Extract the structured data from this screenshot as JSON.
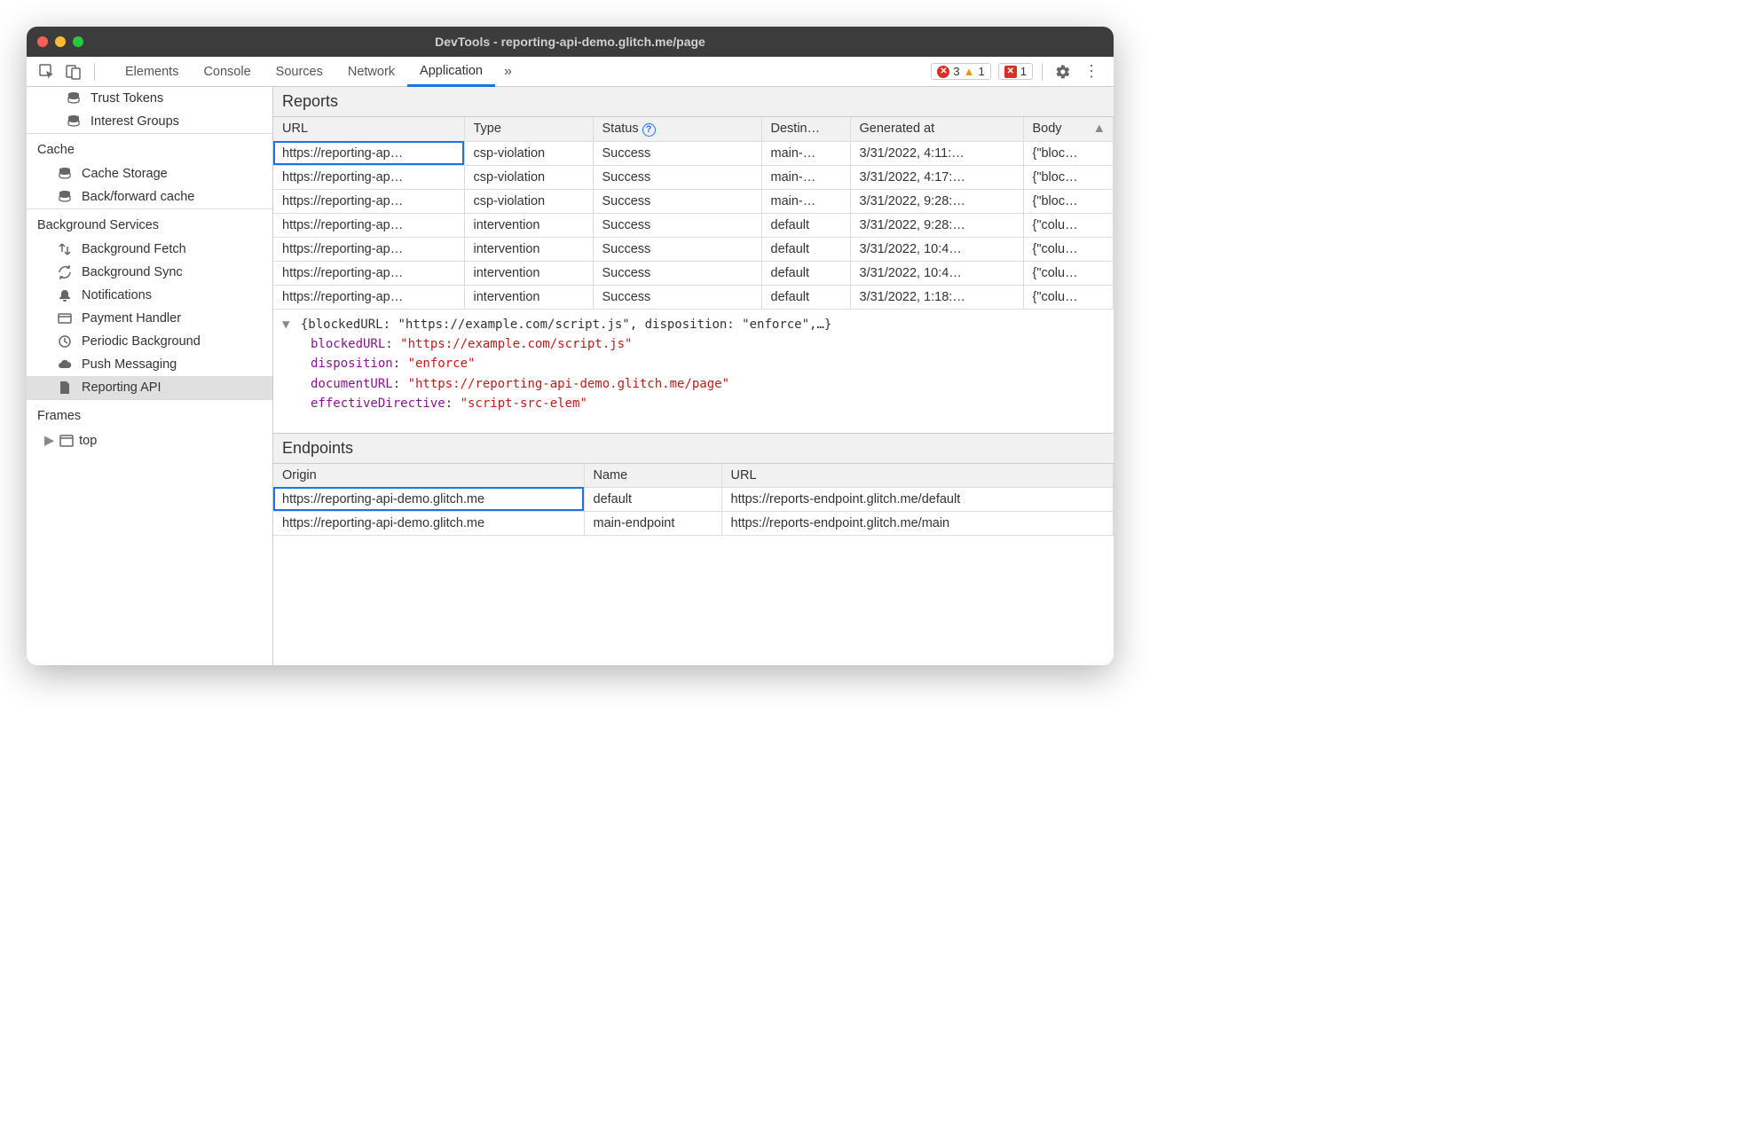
{
  "window": {
    "title": "DevTools - reporting-api-demo.glitch.me/page"
  },
  "toolbar": {
    "tabs": [
      "Elements",
      "Console",
      "Sources",
      "Network",
      "Application"
    ],
    "active_tab": "Application",
    "errors": "3",
    "warnings": "1",
    "issues": "1"
  },
  "sidebar": {
    "top_items": [
      "Trust Tokens",
      "Interest Groups"
    ],
    "groups": [
      {
        "title": "Cache",
        "items": [
          "Cache Storage",
          "Back/forward cache"
        ]
      },
      {
        "title": "Background Services",
        "items": [
          "Background Fetch",
          "Background Sync",
          "Notifications",
          "Payment Handler",
          "Periodic Background",
          "Push Messaging",
          "Reporting API"
        ],
        "selected": "Reporting API"
      },
      {
        "title": "Frames",
        "items": [
          "top"
        ]
      }
    ]
  },
  "reports": {
    "title": "Reports",
    "headers": [
      "URL",
      "Type",
      "Status",
      "Destin…",
      "Generated at",
      "Body"
    ],
    "rows": [
      {
        "url": "https://reporting-ap…",
        "type": "csp-violation",
        "status": "Success",
        "dest": "main-…",
        "gen": "3/31/2022, 4:11:…",
        "body": "{\"bloc…"
      },
      {
        "url": "https://reporting-ap…",
        "type": "csp-violation",
        "status": "Success",
        "dest": "main-…",
        "gen": "3/31/2022, 4:17:…",
        "body": "{\"bloc…"
      },
      {
        "url": "https://reporting-ap…",
        "type": "csp-violation",
        "status": "Success",
        "dest": "main-…",
        "gen": "3/31/2022, 9:28:…",
        "body": "{\"bloc…"
      },
      {
        "url": "https://reporting-ap…",
        "type": "intervention",
        "status": "Success",
        "dest": "default",
        "gen": "3/31/2022, 9:28:…",
        "body": "{\"colu…"
      },
      {
        "url": "https://reporting-ap…",
        "type": "intervention",
        "status": "Success",
        "dest": "default",
        "gen": "3/31/2022, 10:4…",
        "body": "{\"colu…"
      },
      {
        "url": "https://reporting-ap…",
        "type": "intervention",
        "status": "Success",
        "dest": "default",
        "gen": "3/31/2022, 10:4…",
        "body": "{\"colu…"
      },
      {
        "url": "https://reporting-ap…",
        "type": "intervention",
        "status": "Success",
        "dest": "default",
        "gen": "3/31/2022, 1:18:…",
        "body": "{\"colu…"
      }
    ]
  },
  "detail": {
    "summary": "{blockedURL: \"https://example.com/script.js\", disposition: \"enforce\",…}",
    "props": [
      {
        "k": "blockedURL",
        "v": "\"https://example.com/script.js\""
      },
      {
        "k": "disposition",
        "v": "\"enforce\""
      },
      {
        "k": "documentURL",
        "v": "\"https://reporting-api-demo.glitch.me/page\""
      },
      {
        "k": "effectiveDirective",
        "v": "\"script-src-elem\""
      }
    ]
  },
  "endpoints": {
    "title": "Endpoints",
    "headers": [
      "Origin",
      "Name",
      "URL"
    ],
    "rows": [
      {
        "origin": "https://reporting-api-demo.glitch.me",
        "name": "default",
        "url": "https://reports-endpoint.glitch.me/default"
      },
      {
        "origin": "https://reporting-api-demo.glitch.me",
        "name": "main-endpoint",
        "url": "https://reports-endpoint.glitch.me/main"
      }
    ]
  }
}
